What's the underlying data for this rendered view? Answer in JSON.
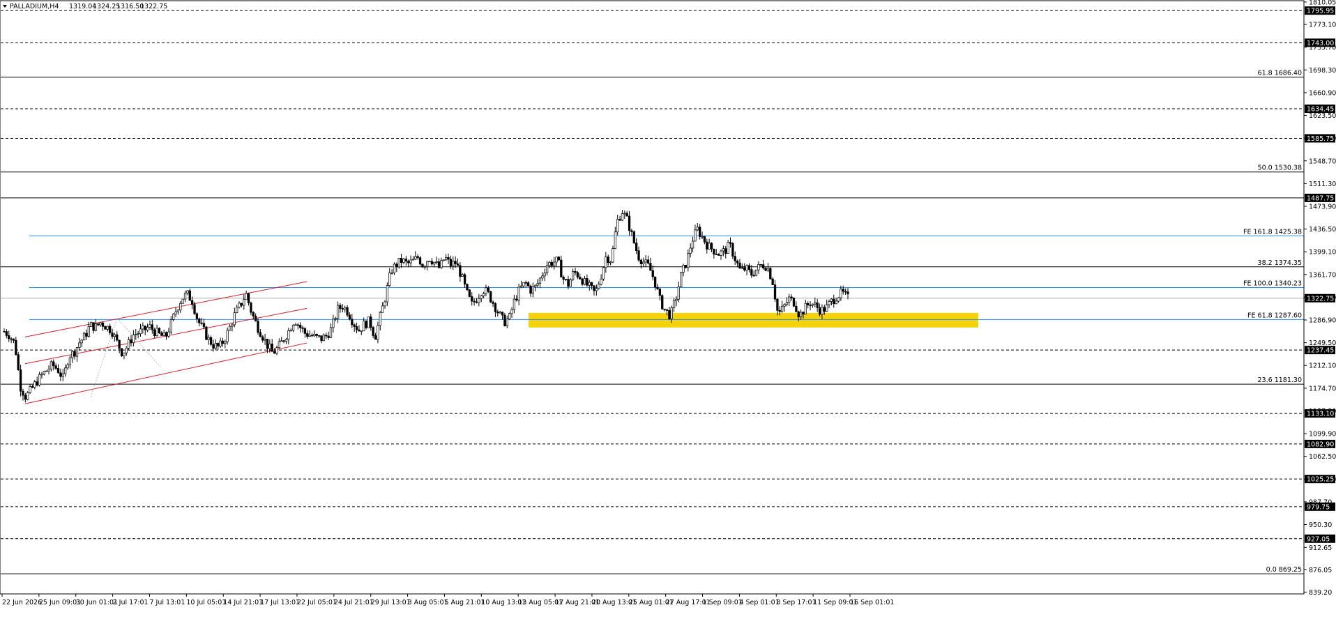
{
  "symbol": "PALLADIUM,H4",
  "ohlc": {
    "open": "1319.04",
    "high": "1324.25",
    "low": "1316.50",
    "close": "1322.75"
  },
  "colors": {
    "resistance": "#000000",
    "channel": "#d11f2a",
    "fe_line": "#1e90ff",
    "zone": "#f5d20a",
    "candle_up": "#ffffff",
    "candle_down": "#000000",
    "last_price_line": "#a9a9a9"
  },
  "chart_data": {
    "type": "candlestick",
    "title": "PALLADIUM,H4",
    "xlabel": "",
    "ylabel": "",
    "ylim": [
      836.2,
      1812.2
    ],
    "grid": false,
    "y_ticks": [
      "1810.05",
      "1773.10",
      "1735.70",
      "1698.30",
      "1660.90",
      "1623.50",
      "1586.10",
      "1548.70",
      "1511.30",
      "1473.90",
      "1436.50",
      "1399.10",
      "1361.70",
      "1324.30",
      "1286.90",
      "1249.50",
      "1212.10",
      "1174.70",
      "1137.30",
      "1099.90",
      "1062.50",
      "1025.10",
      "987.70",
      "950.30",
      "912.65",
      "876.05",
      "839.20"
    ],
    "x_ticks": [
      "22 Jun 2026",
      "25 Jun 09:01",
      "30 Jun 01:01",
      "2 Jul 17:01",
      "7 Jul 13:01",
      "10 Jul 05:01",
      "14 Jul 21:01",
      "17 Jul 13:01",
      "22 Jul 05:01",
      "24 Jul 21:01",
      "29 Jul 13:01",
      "3 Aug 05:01",
      "5 Aug 21:01",
      "10 Aug 13:01",
      "13 Aug 05:01",
      "17 Aug 21:01",
      "20 Aug 13:01",
      "25 Aug 01:01",
      "27 Aug 17:01",
      "1 Sep 09:01",
      "4 Sep 01:01",
      "8 Sep 17:01",
      "11 Sep 09:01",
      "16 Sep 01:01"
    ],
    "last_price": "1322.75",
    "levels": [
      {
        "value": 1795.95,
        "label": "1795.95",
        "style": "dashed"
      },
      {
        "value": 1743.0,
        "label": "1743.00",
        "style": "dashed"
      },
      {
        "value": 1634.45,
        "label": "1634.45",
        "style": "dashed"
      },
      {
        "value": 1585.75,
        "label": "1585.75",
        "style": "dashed"
      },
      {
        "value": 1487.75,
        "label": "1487.75",
        "style": "solid"
      },
      {
        "value": 1237.45,
        "label": "1237.45",
        "style": "dashed"
      },
      {
        "value": 1133.1,
        "label": "1133.10",
        "style": "dashed"
      },
      {
        "value": 1082.9,
        "label": "1082.90",
        "style": "dashed"
      },
      {
        "value": 1025.25,
        "label": "1025.25",
        "style": "dashed"
      },
      {
        "value": 979.75,
        "label": "979.75",
        "style": "dashed"
      },
      {
        "value": 927.05,
        "label": "927.05",
        "style": "dashed"
      }
    ],
    "fib_retracement": [
      {
        "value": 1686.4,
        "label": "61.8 1686.40"
      },
      {
        "value": 1530.38,
        "label": "50.0 1530.38"
      },
      {
        "value": 1374.35,
        "label": "38.2 1374.35"
      },
      {
        "value": 1181.3,
        "label": "23.6 1181.30"
      },
      {
        "value": 869.25,
        "label": "0.0 869.25"
      }
    ],
    "fib_expansion": [
      {
        "value": 1425.38,
        "label": "FE 161.8 1425.38"
      },
      {
        "value": 1340.23,
        "label": "FE 100.0 1340.23"
      },
      {
        "value": 1287.6,
        "label": "FE 61.8 1287.60"
      }
    ],
    "zone": {
      "top": 1298.5,
      "bottom": 1274.5
    },
    "channel": {
      "start_date": "23 Jun 2026",
      "end_date": "22 Jul 2026",
      "upper": [
        1259.0,
        1350.0
      ],
      "middle": [
        1215.0,
        1306.0
      ],
      "lower": [
        1149.0,
        1249.0
      ]
    },
    "series": [
      {
        "name": "PALLADIUM,H4",
        "close_path": [
          1268,
          1262,
          1247,
          1178,
          1160,
          1172,
          1185,
          1196,
          1205,
          1213,
          1205,
          1190,
          1228,
          1233,
          1250,
          1260,
          1278,
          1275,
          1283,
          1276,
          1270,
          1250,
          1232,
          1245,
          1262,
          1266,
          1270,
          1276,
          1268,
          1262,
          1258,
          1280,
          1303,
          1322,
          1330,
          1318,
          1287,
          1271,
          1255,
          1245,
          1242,
          1255,
          1275,
          1298,
          1312,
          1330,
          1300,
          1278,
          1262,
          1245,
          1232,
          1242,
          1255,
          1270,
          1288,
          1276,
          1265,
          1262,
          1258,
          1256,
          1261,
          1274,
          1304,
          1310,
          1300,
          1282,
          1270,
          1280,
          1285,
          1258,
          1293,
          1328,
          1368,
          1378,
          1385,
          1379,
          1383,
          1390,
          1376,
          1390,
          1382,
          1372,
          1390,
          1378,
          1381,
          1362,
          1333,
          1312,
          1323,
          1338,
          1331,
          1315,
          1298,
          1283,
          1290,
          1320,
          1338,
          1348,
          1336,
          1342,
          1360,
          1378,
          1382,
          1384,
          1355,
          1345,
          1366,
          1360,
          1348,
          1340,
          1330,
          1358,
          1392,
          1385,
          1448,
          1466,
          1450,
          1420,
          1392,
          1382,
          1374,
          1352,
          1320,
          1302,
          1294,
          1322,
          1362,
          1383,
          1418,
          1436,
          1422,
          1408,
          1402,
          1396,
          1400,
          1410,
          1388,
          1367,
          1372,
          1362,
          1370,
          1378,
          1375,
          1350,
          1296,
          1307,
          1322,
          1316,
          1294,
          1306,
          1316,
          1310,
          1302,
          1307,
          1318,
          1327,
          1331,
          1322.75
        ]
      }
    ]
  }
}
